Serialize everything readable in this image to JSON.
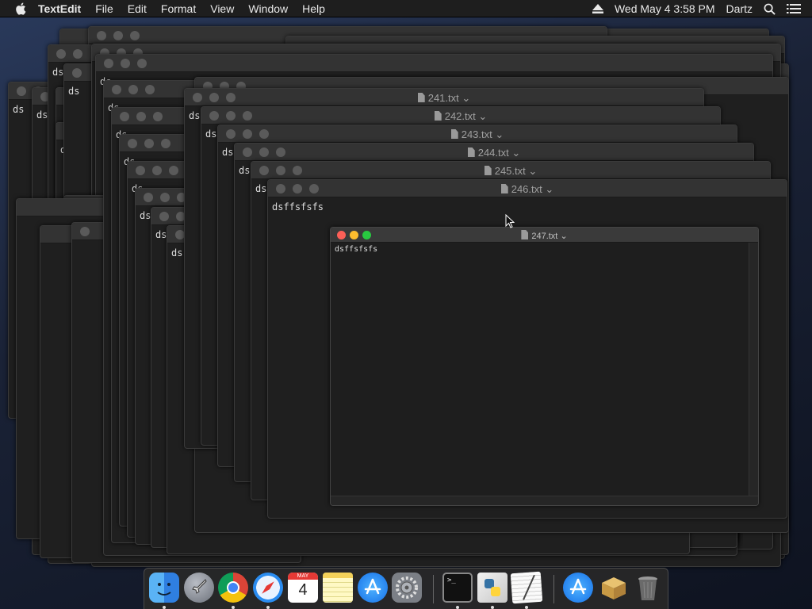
{
  "menubar": {
    "app_name": "TextEdit",
    "menus": [
      "File",
      "Edit",
      "Format",
      "View",
      "Window",
      "Help"
    ],
    "clock": "Wed May 4  3:58 PM",
    "user": "Dartz"
  },
  "windows": {
    "back_content": "ds",
    "w241_title": "241.txt",
    "w242_title": "242.txt",
    "w243_title": "243.txt",
    "w244_title": "244.txt",
    "w245_title": "245.txt",
    "w246_title": "246.txt",
    "w246_content": "dsffsfsfs",
    "w247_title": "247.txt",
    "w247_content": "dsffsfsfs",
    "title_chevron": "⌄"
  },
  "dock": {
    "calendar_month": "MAY",
    "calendar_day": "4",
    "terminal_prompt": ">_"
  },
  "colors": {
    "close": "#fc5f57",
    "minimize": "#fdbc2e",
    "zoom": "#28c840",
    "window_bg": "#1f1f1f"
  }
}
